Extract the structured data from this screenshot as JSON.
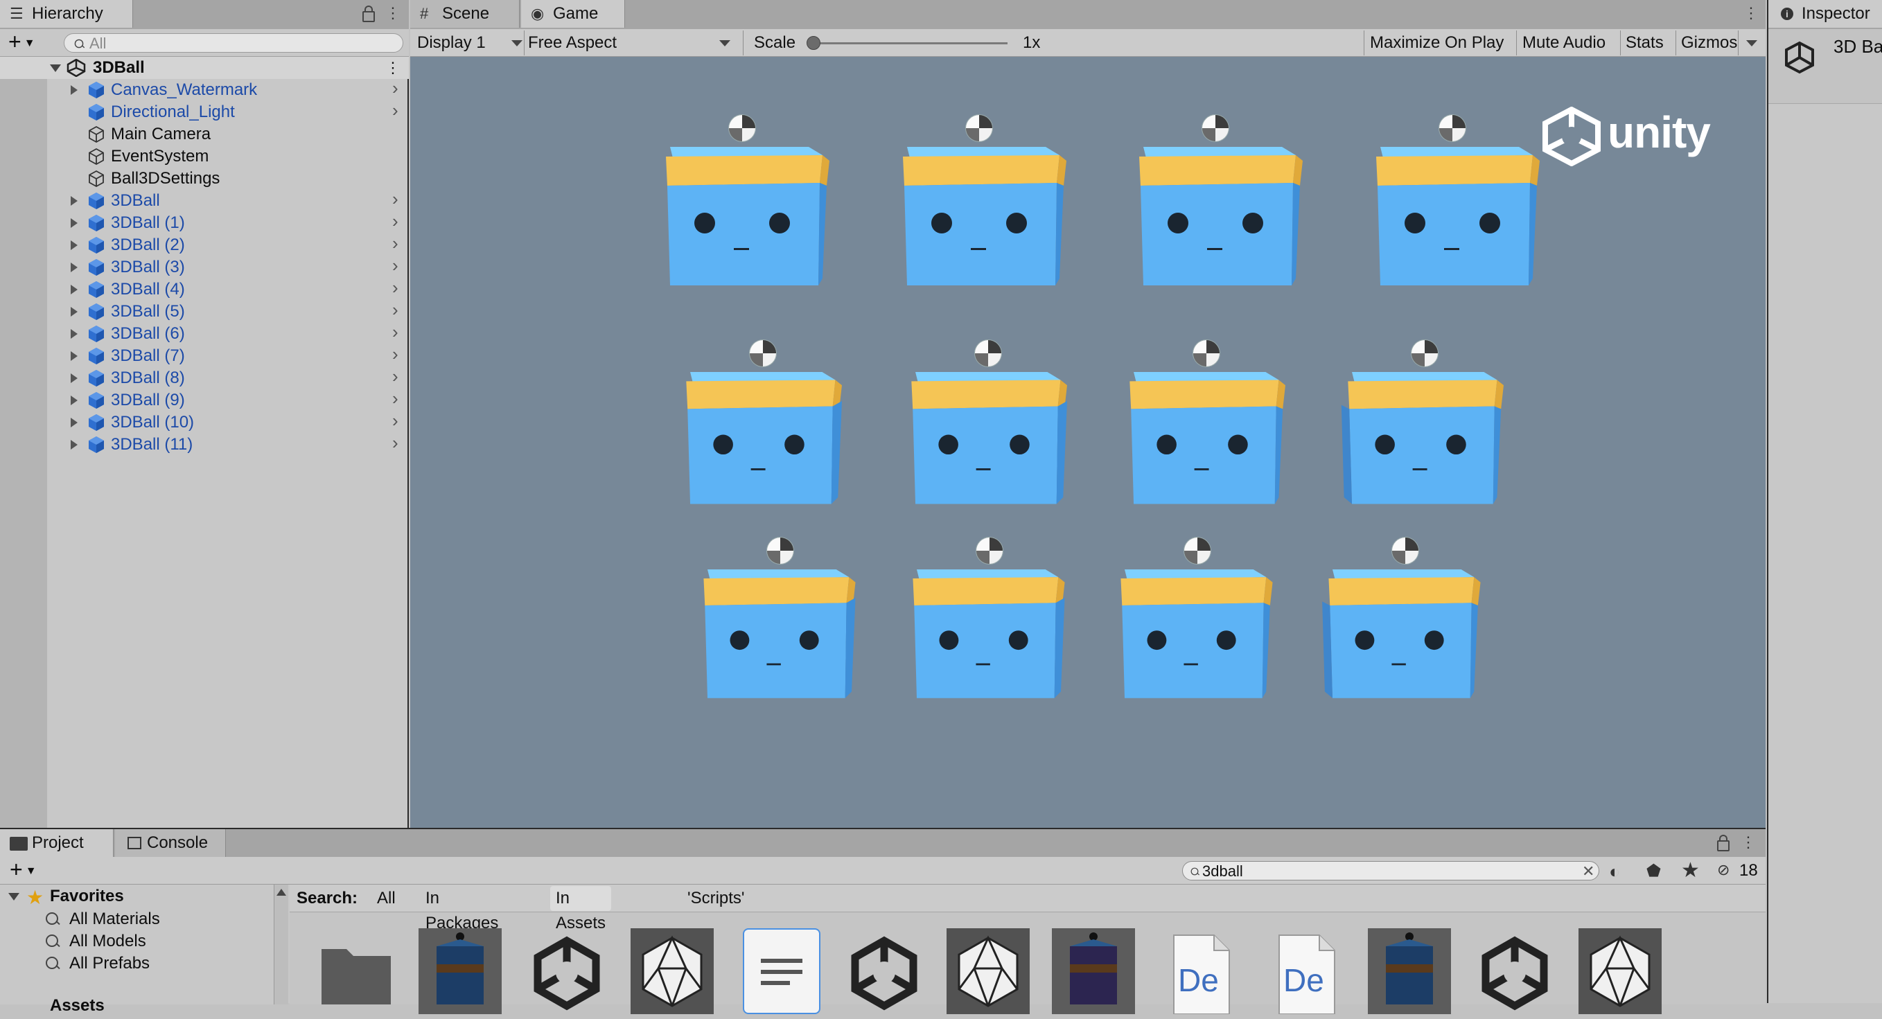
{
  "hierarchy": {
    "tab_label": "Hierarchy",
    "search_placeholder": "All",
    "root_label": "3DBall",
    "items": [
      {
        "label": "Canvas_Watermark",
        "blue": true,
        "expandable": true
      },
      {
        "label": "Directional_Light",
        "blue": true,
        "expandable": false
      },
      {
        "label": "Main Camera",
        "blue": false,
        "expandable": false
      },
      {
        "label": "EventSystem",
        "blue": false,
        "expandable": false
      },
      {
        "label": "Ball3DSettings",
        "blue": false,
        "expandable": false
      },
      {
        "label": "3DBall",
        "blue": true,
        "expandable": true
      },
      {
        "label": "3DBall (1)",
        "blue": true,
        "expandable": true
      },
      {
        "label": "3DBall (2)",
        "blue": true,
        "expandable": true
      },
      {
        "label": "3DBall (3)",
        "blue": true,
        "expandable": true
      },
      {
        "label": "3DBall (4)",
        "blue": true,
        "expandable": true
      },
      {
        "label": "3DBall (5)",
        "blue": true,
        "expandable": true
      },
      {
        "label": "3DBall (6)",
        "blue": true,
        "expandable": true
      },
      {
        "label": "3DBall (7)",
        "blue": true,
        "expandable": true
      },
      {
        "label": "3DBall (8)",
        "blue": true,
        "expandable": true
      },
      {
        "label": "3DBall (9)",
        "blue": true,
        "expandable": true
      },
      {
        "label": "3DBall (10)",
        "blue": true,
        "expandable": true
      },
      {
        "label": "3DBall (11)",
        "blue": true,
        "expandable": true
      }
    ]
  },
  "center_tabs": {
    "scene_label": "Scene",
    "game_label": "Game"
  },
  "game_toolbar": {
    "display": "Display 1",
    "aspect": "Free Aspect",
    "scale_label": "Scale",
    "scale_value": "1x",
    "maximize": "Maximize On Play",
    "mute": "Mute Audio",
    "stats": "Stats",
    "gizmos": "Gizmos"
  },
  "game_view": {
    "logo_text": "unity",
    "agent_rows": 3,
    "agent_cols": 4
  },
  "inspector": {
    "tab_label": "Inspector",
    "object_label": "3D Ba"
  },
  "project": {
    "project_tab": "Project",
    "console_tab": "Console",
    "search_value": "3dball",
    "hidden_count": "18",
    "favorites_label": "Favorites",
    "favorites": [
      "All Materials",
      "All Models",
      "All Prefabs"
    ],
    "assets_label": "Assets",
    "search_label": "Search:",
    "filters": [
      "All",
      "In Packages",
      "In Assets",
      "'Scripts'"
    ],
    "active_filter": "In Assets",
    "asset_icons": [
      "folder-icon",
      "prefab-icon",
      "unity-logo-icon",
      "model-icon",
      "script-icon",
      "unity-logo-icon",
      "model-icon",
      "prefab-icon",
      "document-icon",
      "document-icon",
      "prefab-icon",
      "unity-logo-icon",
      "model-icon"
    ],
    "doc_text": "De"
  },
  "colors": {
    "game_bg": "#778898",
    "agent_blue": "#5db3f5",
    "headband": "#f5c555",
    "link_blue": "#1c4aa8"
  }
}
